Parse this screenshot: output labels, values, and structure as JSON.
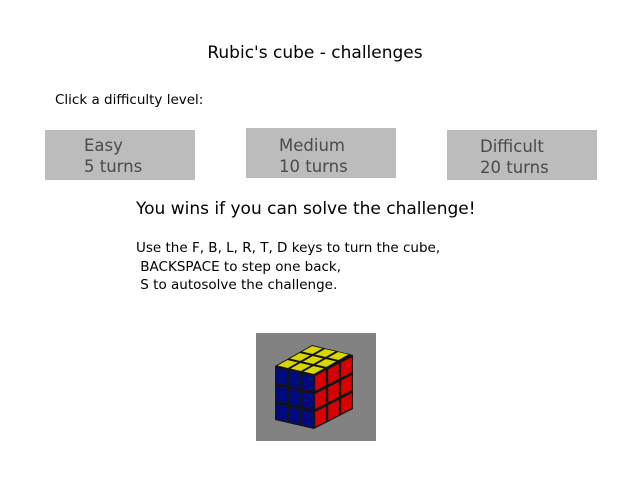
{
  "title": "Rubic's cube - challenges",
  "prompt": "Click a difficulty level:",
  "levels": [
    {
      "name": "Easy",
      "turns": "5 turns"
    },
    {
      "name": "Medium",
      "turns": "10 turns"
    },
    {
      "name": "Difficult",
      "turns": "20 turns"
    }
  ],
  "headline": "You wins if you can solve the challenge!",
  "instructions": [
    "Use the F, B, L, R, T, D keys to turn the cube,",
    " BACKSPACE to step one back,",
    " S to autosolve the challenge."
  ],
  "cube": {
    "colors": {
      "top": "#d8d800",
      "left": "#000a80",
      "right": "#d80000",
      "background": "#828282"
    }
  }
}
